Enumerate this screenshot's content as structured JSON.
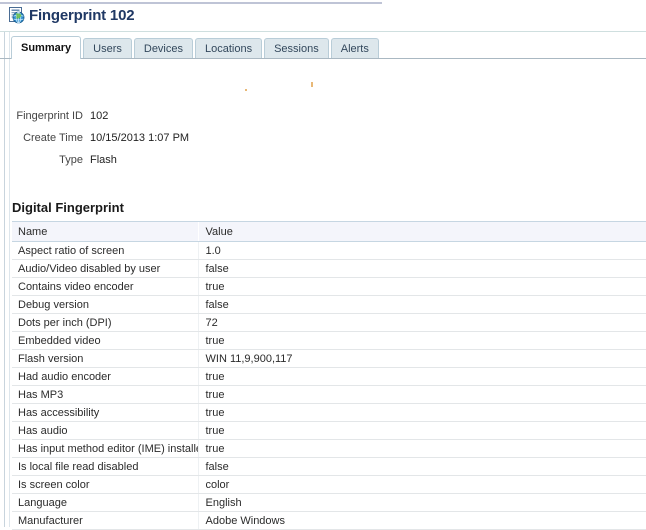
{
  "header": {
    "icon": "page-globe-icon",
    "title": "Fingerprint 102"
  },
  "tabs": [
    {
      "label": "Summary",
      "selected": true
    },
    {
      "label": "Users",
      "selected": false
    },
    {
      "label": "Devices",
      "selected": false
    },
    {
      "label": "Locations",
      "selected": false
    },
    {
      "label": "Sessions",
      "selected": false
    },
    {
      "label": "Alerts",
      "selected": false
    }
  ],
  "summary_fields": [
    {
      "label": "Fingerprint ID",
      "value": "102"
    },
    {
      "label": "Create Time",
      "value": "10/15/2013 1:07 PM"
    },
    {
      "label": "Type",
      "value": "Flash"
    }
  ],
  "section": {
    "heading": "Digital Fingerprint"
  },
  "table": {
    "columns": [
      "Name",
      "Value"
    ],
    "rows": [
      {
        "name": "Aspect ratio of screen",
        "value": "1.0"
      },
      {
        "name": "Audio/Video disabled by user",
        "value": "false"
      },
      {
        "name": "Contains video encoder",
        "value": "true"
      },
      {
        "name": "Debug version",
        "value": "false"
      },
      {
        "name": "Dots per inch (DPI)",
        "value": "72"
      },
      {
        "name": "Embedded video",
        "value": "true"
      },
      {
        "name": "Flash version",
        "value": "WIN 11,9,900,117"
      },
      {
        "name": "Had audio encoder",
        "value": "true"
      },
      {
        "name": "Has MP3",
        "value": "true"
      },
      {
        "name": "Has accessibility",
        "value": "true"
      },
      {
        "name": "Has audio",
        "value": "true"
      },
      {
        "name": "Has input method editor (IME) installed",
        "value": "true"
      },
      {
        "name": "Is local file read disabled",
        "value": "false"
      },
      {
        "name": "Is screen color",
        "value": "color"
      },
      {
        "name": "Language",
        "value": "English"
      },
      {
        "name": "Manufacturer",
        "value": "Adobe Windows"
      }
    ]
  },
  "colors": {
    "title": "#1f3864",
    "tab_inactive_bg": "#dde7ec",
    "tab_border": "#b9cdd8",
    "table_header_bg": "#f4f5fb",
    "row_divider": "#e3e6e8",
    "artifact": "#e8b877"
  }
}
